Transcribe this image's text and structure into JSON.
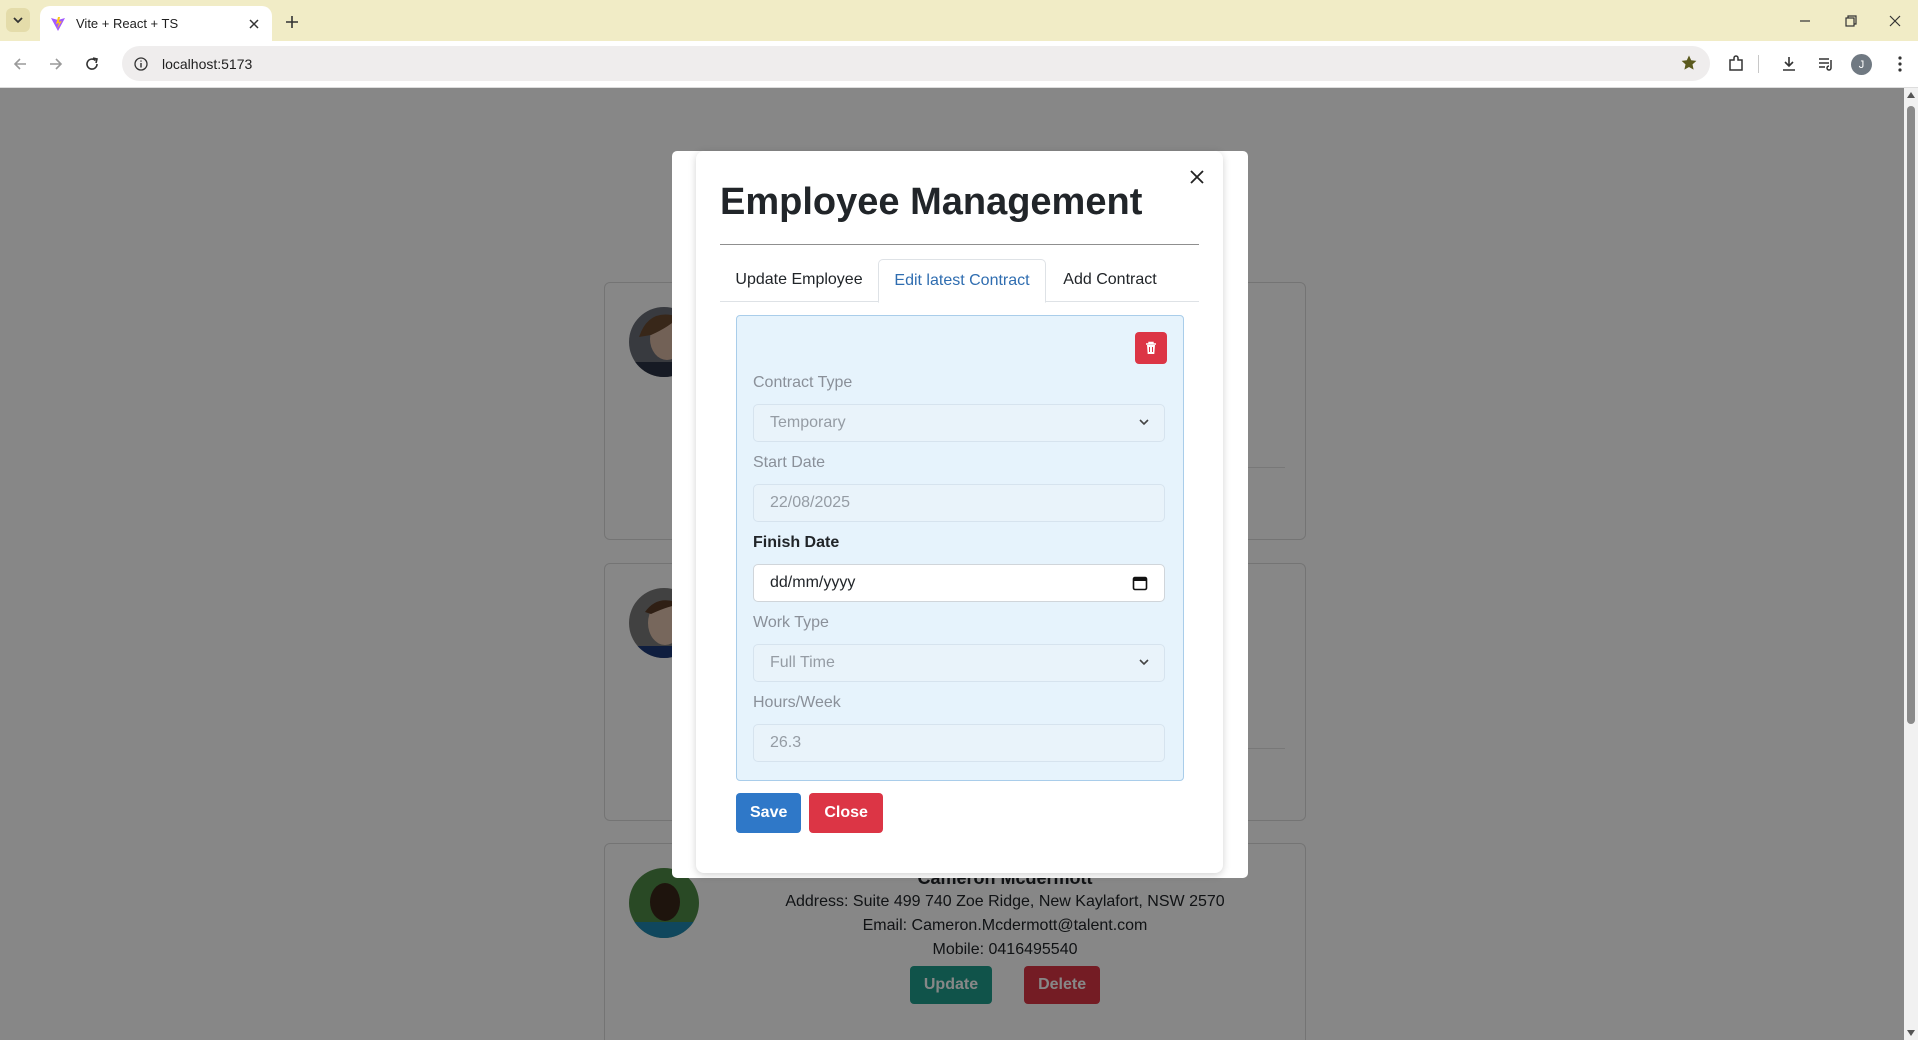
{
  "browser": {
    "tab_title": "Vite + React + TS",
    "url": "localhost:5173",
    "profile_initial": "J"
  },
  "employees": [
    {
      "name": "",
      "address": "",
      "email": "",
      "mobile": ""
    },
    {
      "name": "",
      "address": "",
      "email": "",
      "mobile": ""
    },
    {
      "name": "Cameron Mcdermott",
      "address": "Address: Suite 499 740 Zoe Ridge, New Kaylafort, NSW 2570",
      "email": "Email: Cameron.Mcdermott@talent.com",
      "mobile": "Mobile: 0416495540"
    }
  ],
  "card_actions": {
    "update_label": "Update",
    "delete_label": "Delete"
  },
  "modal": {
    "title": "Employee Management",
    "tabs": [
      {
        "label": "Update Employee",
        "active": false
      },
      {
        "label": "Edit latest Contract",
        "active": true
      },
      {
        "label": "Add Contract",
        "active": false
      }
    ],
    "contract": {
      "contract_type_label": "Contract Type",
      "contract_type_value": "Temporary",
      "start_date_label": "Start Date",
      "start_date_value": "22/08/2025",
      "finish_date_label": "Finish Date",
      "finish_date_placeholder": "dd/mm/yyyy",
      "work_type_label": "Work Type",
      "work_type_value": "Full Time",
      "hours_label": "Hours/Week",
      "hours_value": "26.3"
    },
    "save_label": "Save",
    "close_label": "Close"
  },
  "colors": {
    "primary": "#2f78c8",
    "danger": "#dc3545",
    "teal": "#1f9e8c",
    "panel_bg": "#e6f3fc",
    "chrome": "#f1ecc6"
  },
  "icons": [
    "tab-list-icon",
    "vite-favicon",
    "close-tab-icon",
    "new-tab-icon",
    "minimize-icon",
    "restore-icon",
    "close-window-icon",
    "back-icon",
    "forward-icon",
    "reload-icon",
    "site-info-icon",
    "bookmark-star-icon",
    "extensions-icon",
    "download-icon",
    "media-icon",
    "menu-icon",
    "modal-close-icon",
    "trash-icon",
    "chevron-down-icon",
    "calendar-icon"
  ]
}
